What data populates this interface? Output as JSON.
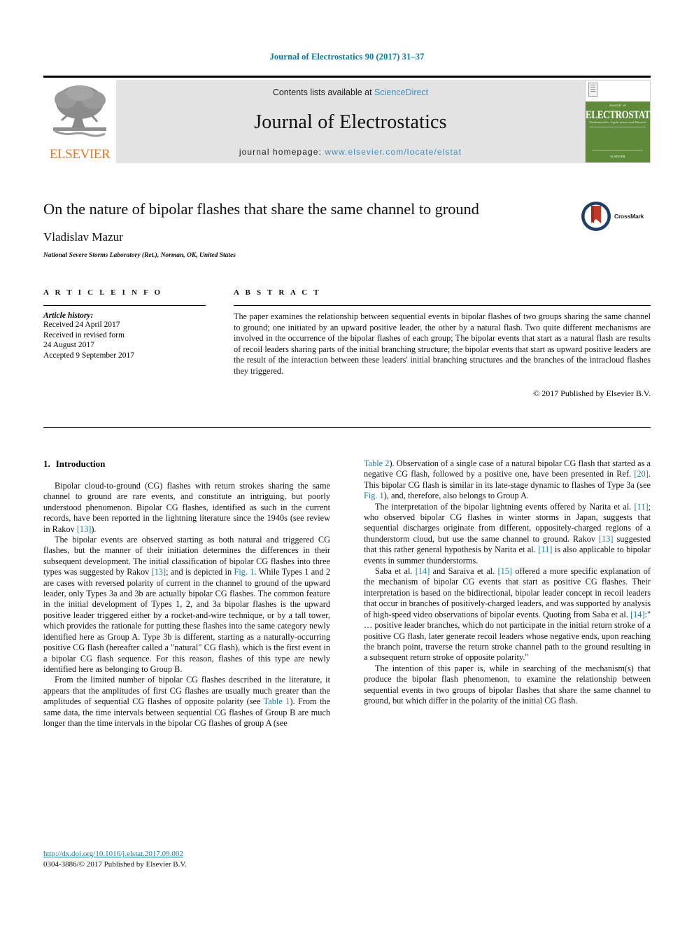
{
  "running_head": "Journal of Electrostatics 90 (2017) 31–37",
  "masthead": {
    "publisher_wordmark": "ELSEVIER",
    "contents_prefix": "Contents lists available at ",
    "contents_link": "ScienceDirect",
    "journal_name": "Journal of Electrostatics",
    "homepage_prefix": "journal homepage: ",
    "homepage_link": "www.elsevier.com/locate/elstat",
    "cover": {
      "kicker": "Journal of",
      "title": "ELECTROSTATICS",
      "subtitle": "Fundamentals, Applications and Hazards",
      "bottom": "ELSEVIER"
    },
    "colors": {
      "banner_bg": "#e3e3e3",
      "link": "#3b8fc4",
      "elsevier_orange": "#e87722",
      "cover_green": "#5f8a3a"
    }
  },
  "title_block": {
    "title": "On the nature of bipolar flashes that share the same channel to ground",
    "author": "Vladislav Mazur",
    "affiliation": "National Severe Storms Laboratory (Ret.), Norman, OK, United States",
    "crossmark_label": "CrossMark"
  },
  "article_info": {
    "heading": "A R T I C L E   I N F O",
    "history_label": "Article history:",
    "history_lines": [
      "Received 24 April 2017",
      "Received in revised form",
      "24 August 2017",
      "Accepted 9 September 2017"
    ]
  },
  "abstract": {
    "heading": "A B S T R A C T",
    "text": "The paper examines the relationship between sequential events in bipolar flashes of two groups sharing the same channel to ground; one initiated by an upward positive leader, the other by a natural flash. Two quite different mechanisms are involved in the occurrence of the bipolar flashes of each group; The bipolar events that start as a natural flash are results of recoil leaders sharing parts of the initial branching structure; the bipolar events that start as upward positive leaders are the result of the interaction between these leaders' initial branching structures and the branches of the intracloud flashes they triggered.",
    "copyright": "© 2017 Published by Elsevier B.V."
  },
  "body": {
    "section_number": "1.",
    "section_title": "Introduction",
    "left_paragraphs": [
      "Bipolar cloud-to-ground (CG) flashes with return strokes sharing the same channel to ground are rare events, and constitute an intriguing, but poorly understood phenomenon. Bipolar CG flashes, identified as such in the current records, have been reported in the lightning literature since the 1940s (see review in Rakov [13]).",
      "The bipolar events are observed starting as both natural and triggered CG flashes, but the manner of their initiation determines the differences in their subsequent development. The initial classification of bipolar CG flashes into three types was suggested by Rakov [13]; and is depicted in Fig. 1. While Types 1 and 2 are cases with reversed polarity of current in the channel to ground of the upward leader, only Types 3a and 3b are actually bipolar CG flashes. The common feature in the initial development of Types 1, 2, and 3a bipolar flashes is the upward positive leader triggered either by a rocket-and-wire technique, or by a tall tower, which provides the rationale for putting these flashes into the same category newly identified here as Group A. Type 3b is different, starting as a naturally-occurring positive CG flash (hereafter called a \"natural\" CG flash), which is the first event in a bipolar CG flash sequence. For this reason, flashes of this type are newly identified here as belonging to Group B.",
      "From the limited number of bipolar CG flashes described in the literature, it appears that the amplitudes of first CG flashes are usually much greater than the amplitudes of sequential CG flashes of opposite polarity (see Table 1). From the same data, the time intervals between sequential CG flashes of Group B are much longer than the time intervals in the bipolar CG flashes of group A (see"
    ],
    "right_paragraphs": [
      "Table 2). Observation of a single case of a natural bipolar CG flash that started as a negative CG flash, followed by a positive one, have been presented in Ref. [20]. This bipolar CG flash is similar in its late-stage dynamic to flashes of Type 3a (see Fig. 1), and, therefore, also belongs to Group A.",
      "The interpretation of the bipolar lightning events offered by Narita et al. [11]; who observed bipolar CG flashes in winter storms in Japan, suggests that sequential discharges originate from different, oppositely-charged regions of a thunderstorm cloud, but use the same channel to ground. Rakov [13] suggested that this rather general hypothesis by Narita et al. [11] is also applicable to bipolar events in summer thunderstorms.",
      "Saba et al. [14] and Saraiva et al. [15] offered a more specific explanation of the mechanism of bipolar CG events that start as positive CG flashes. Their interpretation is based on the bidirectional, bipolar leader concept in recoil leaders that occur in branches of positively-charged leaders, and was supported by analysis of high-speed video observations of bipolar events. Quoting from Saba et al. [14]:\" … positive leader branches, which do not participate in the initial return stroke of a positive CG flash, later generate recoil leaders whose negative ends, upon reaching the branch point, traverse the return stroke channel path to the ground resulting in a subsequent return stroke of opposite polarity.\"",
      "The intention of this paper is, while in searching of the mechanism(s) that produce the bipolar flash phenomenon, to examine the relationship between sequential events in two groups of bipolar flashes that share the same channel to ground, but which differ in the polarity of the initial CG flash."
    ],
    "reference_tokens": [
      "[13]",
      "Fig. 1",
      "Table 1",
      "Table 2",
      "[20]",
      "[11]",
      "[14]",
      "[15]"
    ],
    "link_color": "#1a7ba8"
  },
  "footer": {
    "doi": "http://dx.doi.org/10.1016/j.elstat.2017.09.002",
    "issn_line": "0304-3886/© 2017 Published by Elsevier B.V."
  }
}
